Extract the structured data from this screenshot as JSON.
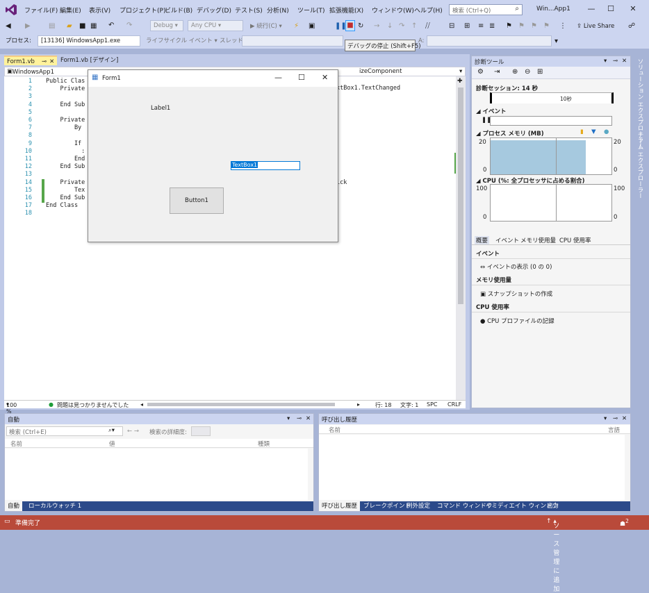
{
  "menubar": {
    "items": [
      "ファイル(F)",
      "編集(E)",
      "表示(V)",
      "プロジェクト(P)",
      "ビルド(B)",
      "デバッグ(D)",
      "テスト(S)",
      "分析(N)",
      "ツール(T)",
      "拡張機能(X)",
      "ウィンドウ(W)",
      "ヘルプ(H)"
    ],
    "search_placeholder": "検索 (Ctrl+Q)",
    "window_title": "Win...App1",
    "accent": "#68217a"
  },
  "toolbar": {
    "config": "Debug",
    "platform": "Any CPU",
    "continue_label": "続行(C)",
    "live_share": "Live Share",
    "process_label": "プロセス:",
    "process_value": "[13136] WindowsApp1.exe",
    "lifecycle_label": "ライフサイクル イベント",
    "thread_label": "スレッド:",
    "frame_label": "A:",
    "tooltip": "デバッグの停止 (Shift+F5)"
  },
  "tabs": {
    "tab1": "Form1.vb",
    "tab2": "Form1.vb [デザイン]"
  },
  "navbar": {
    "left": "WindowsApp1",
    "right": "izeComponent"
  },
  "code_lines": [
    {
      "n": "1",
      "text": "Public Clas"
    },
    {
      "n": "2",
      "text": "    Private"
    },
    {
      "n": "3",
      "text": ""
    },
    {
      "n": "4",
      "text": "    End Sub"
    },
    {
      "n": "5",
      "text": ""
    },
    {
      "n": "6",
      "text": "    Private"
    },
    {
      "n": "7",
      "text": "        By"
    },
    {
      "n": "8",
      "text": ""
    },
    {
      "n": "9",
      "text": "        If"
    },
    {
      "n": "10",
      "text": "          :"
    },
    {
      "n": "11",
      "text": "        End"
    },
    {
      "n": "12",
      "text": "    End Sub"
    },
    {
      "n": "13",
      "text": ""
    },
    {
      "n": "14",
      "text": "    Private"
    },
    {
      "n": "15",
      "text": "        Tex"
    },
    {
      "n": "16",
      "text": "    End Sub"
    },
    {
      "n": "17",
      "text": "End Class"
    },
    {
      "n": "18",
      "text": ""
    }
  ],
  "code_right": {
    "line2": "xtBox1.TextChanged",
    "line14": "ick"
  },
  "editor_status": {
    "zoom": "100 %",
    "issues": "問題は見つかりませんでした",
    "line": "行: 18",
    "char": "文字: 1",
    "spc": "SPC",
    "crlf": "CRLF"
  },
  "form1": {
    "title": "Form1",
    "label": "Label1",
    "textbox": "TextBox1",
    "button": "Button1"
  },
  "diag": {
    "title": "診断ツール",
    "session": "診断セッション: 14 秒",
    "ten_sec": "10秒",
    "events": "イベント",
    "process_memory": "プロセス メモリ (MB)",
    "mem_max": "20",
    "mem_min": "0",
    "cpu": "CPU (%: 全プロセッサに占める割合)",
    "cpu_max": "100",
    "cpu_min": "0",
    "tab_summary": "概要",
    "tab_events": "イベント",
    "tab_memory": "メモリ使用量",
    "tab_cpu": "CPU 使用率",
    "sec_events": "イベント",
    "show_events": "イベントの表示 (0 の 0)",
    "sec_memory": "メモリ使用量",
    "snapshot": "スナップショットの作成",
    "sec_cpu": "CPU 使用率",
    "cpu_profile": "CPU プロファイルの記録",
    "memory_level": 0.95
  },
  "sidetabs": {
    "solution": "ソリューション エクスプローラー",
    "team": "チーム エクスプローラー"
  },
  "autos": {
    "title": "自動",
    "search": "検索 (Ctrl+E)",
    "depth": "検索の詳細度:",
    "col_name": "名前",
    "col_value": "値",
    "col_type": "種類",
    "tab_auto": "自動",
    "tab_local": "ローカル",
    "tab_watch": "ウォッチ 1"
  },
  "callstack": {
    "title": "呼び出し履歴",
    "col_name": "名前",
    "col_lang": "言語",
    "tabs": [
      "呼び出し履歴",
      "ブレークポイント",
      "例外設定",
      "コマンド ウィンドウ",
      "イミディエイト ウィンドウ",
      "出力"
    ]
  },
  "status": {
    "ready": "準備完了",
    "source": "ソース管理に追加",
    "badge": "2",
    "bg": "#b94a3a"
  }
}
